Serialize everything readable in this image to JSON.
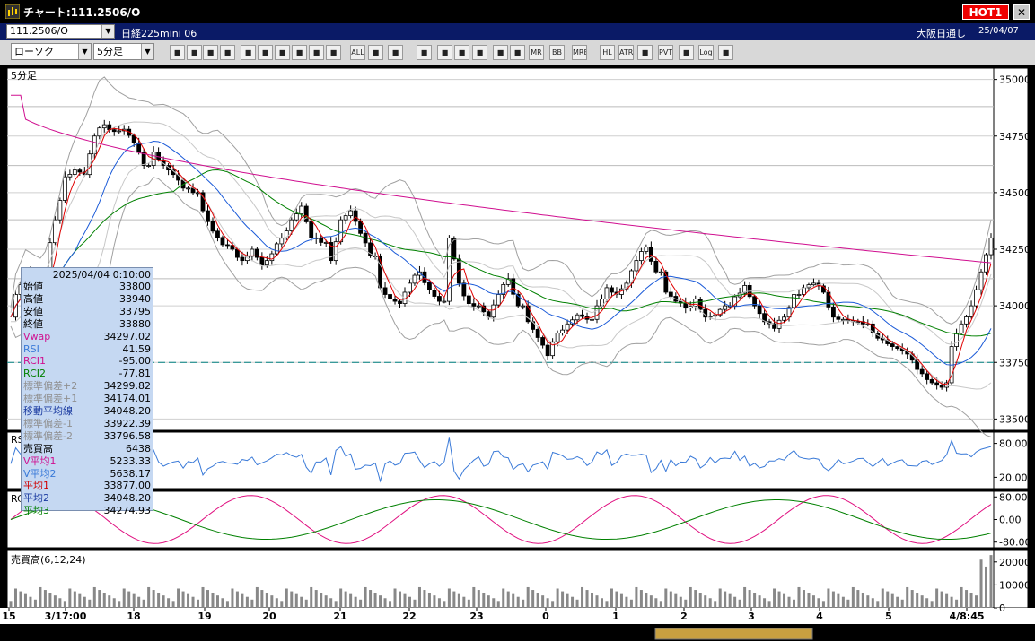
{
  "window": {
    "title": "チャート:111.2506/O",
    "hot_label": "HOT1",
    "close_label": "✕"
  },
  "infobar": {
    "symbol": "111.2506/O",
    "instrument": "日経225mini 06",
    "market": "大阪日通し",
    "date": "25/04/07"
  },
  "toolbar": {
    "chart_type": "ローソク",
    "interval": "5分足",
    "buttons": [
      "zoom",
      "crosshair",
      "draw-line",
      "pointer",
      "cursor",
      "redo",
      "memo",
      "delete",
      "zoom-in",
      "zoom-out",
      "all",
      "settings",
      "tools",
      "color",
      "print",
      "search",
      "table",
      "compare",
      "info",
      "mr",
      "bb",
      "mre",
      "hl",
      "atr",
      "pair",
      "pvt",
      "box",
      "log",
      "exit"
    ],
    "btn_text": {
      "all": "ALL",
      "mr": "MR",
      "bb": "BB",
      "mre": "MRE",
      "hl": "HL",
      "atr": "ATR",
      "pvt": "PVT",
      "log": "Log"
    }
  },
  "main_pane": {
    "label": "5分足",
    "y_ticks": [
      "35000",
      "34750",
      "34500",
      "34250",
      "34000",
      "33750",
      "33500"
    ]
  },
  "rsi_pane": {
    "label": "RSI",
    "y_ticks": [
      "80.00",
      "20.00"
    ]
  },
  "rci_pane": {
    "label": "RCI",
    "y_ticks": [
      "80.00",
      "0.00",
      "-80.00"
    ]
  },
  "volume_pane": {
    "label": "売買高(6,12,24)",
    "y_ticks": [
      "20000",
      "10000",
      "0"
    ]
  },
  "x_ticks": [
    "15",
    "3/17:00",
    "18",
    "19",
    "20",
    "21",
    "22",
    "23",
    "0",
    "1",
    "2",
    "3",
    "4",
    "5",
    "4/8:45"
  ],
  "info_panel": {
    "datetime": "2025/04/04 0:10:00",
    "rows": [
      {
        "label": "始値",
        "value": "33800",
        "color": "#000000"
      },
      {
        "label": "高値",
        "value": "33940",
        "color": "#000000"
      },
      {
        "label": "安値",
        "value": "33795",
        "color": "#000000"
      },
      {
        "label": "終値",
        "value": "33880",
        "color": "#000000"
      },
      {
        "label": "Vwap",
        "value": "34297.02",
        "color": "#d01090"
      },
      {
        "label": "RSI",
        "value": "41.59",
        "color": "#3a7ad8"
      },
      {
        "label": "RCI1",
        "value": "-95.00",
        "color": "#d01090"
      },
      {
        "label": "RCI2",
        "value": "-77.81",
        "color": "#008000"
      },
      {
        "label": "標準偏差+2",
        "value": "34299.82",
        "color": "#909090"
      },
      {
        "label": "標準偏差+1",
        "value": "34174.01",
        "color": "#909090"
      },
      {
        "label": "移動平均線",
        "value": "34048.20",
        "color": "#1a3aa0"
      },
      {
        "label": "標準偏差-1",
        "value": "33922.39",
        "color": "#909090"
      },
      {
        "label": "標準偏差-2",
        "value": "33796.58",
        "color": "#909090"
      },
      {
        "label": "売買高",
        "value": "6438",
        "color": "#000000"
      },
      {
        "label": "V平均1",
        "value": "5233.33",
        "color": "#d01090"
      },
      {
        "label": "V平均2",
        "value": "5638.17",
        "color": "#3a7ad8"
      },
      {
        "label": "平均1",
        "value": "33877.00",
        "color": "#d00000"
      },
      {
        "label": "平均2",
        "value": "34048.20",
        "color": "#1a3aa0"
      },
      {
        "label": "平均3",
        "value": "34274.93",
        "color": "#008000"
      }
    ]
  },
  "colors": {
    "chart_bg": "#ffffff",
    "candle": "#000000",
    "ma1": "#e00000",
    "ma2": "#1a5ad8",
    "ma3": "#008000",
    "vwap": "#d01090",
    "bands": "#a0a0a0",
    "rsi": "#3a7ad8",
    "rci1": "#e01080",
    "rci2": "#008000",
    "volume": "#888888",
    "level_line": "#008080"
  },
  "chart_data": {
    "type": "candlestick",
    "price_ylim": [
      33450,
      35050
    ],
    "level_line": 33750,
    "sessions": [
      {
        "label": "15",
        "points": [
          33950,
          34050,
          34150,
          34000
        ]
      },
      {
        "label": "3/17:00",
        "points": [
          34000,
          34160,
          34380,
          34570,
          34600,
          34580,
          34750,
          34800,
          34770,
          34780,
          34720,
          34620
        ]
      },
      {
        "label": "18",
        "points": [
          34620,
          34680,
          34620,
          34580,
          34520,
          34500
        ]
      },
      {
        "label": "19",
        "points": [
          34500,
          34420,
          34330,
          34270,
          34250,
          34200,
          34250,
          34180
        ]
      },
      {
        "label": "20",
        "points": [
          34200,
          34230,
          34300,
          34380,
          34440,
          34300,
          34280
        ]
      },
      {
        "label": "21",
        "points": [
          34280,
          34200,
          34380,
          34420,
          34320,
          34220
        ]
      },
      {
        "label": "22",
        "points": [
          34220,
          34080,
          34030,
          34010,
          34100,
          34150,
          34070,
          34020
        ]
      },
      {
        "label": "23",
        "points": [
          34020,
          34300,
          34100,
          34010,
          34000,
          33950,
          34050,
          34120,
          34000
        ]
      },
      {
        "label": "0",
        "points": [
          34000,
          33930,
          33860,
          33780,
          33880,
          33920,
          33960,
          33940
        ]
      },
      {
        "label": "1",
        "points": [
          33940,
          34000,
          34080,
          34050,
          34100,
          34200,
          34260,
          34150
        ]
      },
      {
        "label": "2",
        "points": [
          34150,
          34060,
          34020,
          33990,
          34030,
          33950,
          33960,
          34000
        ]
      },
      {
        "label": "3",
        "points": [
          34000,
          34040,
          34090,
          34000,
          33930,
          33900,
          33950,
          34050
        ]
      },
      {
        "label": "4",
        "points": [
          34050,
          34080,
          34100,
          34060,
          33950,
          33940,
          33930,
          33920
        ]
      },
      {
        "label": "5",
        "points": [
          33920,
          33880,
          33850,
          33820,
          33800,
          33760,
          33700,
          33660,
          33640
        ]
      },
      {
        "label": "4/8:45",
        "points": [
          33660,
          33820,
          33920,
          34000,
          34150,
          34300
        ]
      }
    ],
    "vwap_start": 34880,
    "vwap_end": 34190,
    "rsi_ylim": [
      0,
      100
    ],
    "rci_ylim": [
      -100,
      100
    ],
    "volume_ylim": [
      0,
      25000
    ],
    "volume_spike": [
      21000,
      18000,
      23000
    ]
  }
}
